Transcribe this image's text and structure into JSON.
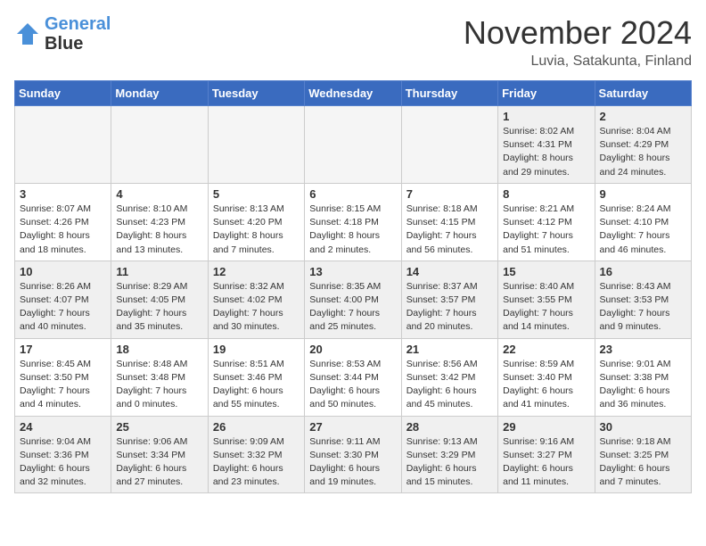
{
  "header": {
    "logo_line1": "General",
    "logo_line2": "Blue",
    "month": "November 2024",
    "location": "Luvia, Satakunta, Finland"
  },
  "weekdays": [
    "Sunday",
    "Monday",
    "Tuesday",
    "Wednesday",
    "Thursday",
    "Friday",
    "Saturday"
  ],
  "weeks": [
    [
      {
        "day": "",
        "info": "",
        "empty": true
      },
      {
        "day": "",
        "info": "",
        "empty": true
      },
      {
        "day": "",
        "info": "",
        "empty": true
      },
      {
        "day": "",
        "info": "",
        "empty": true
      },
      {
        "day": "",
        "info": "",
        "empty": true
      },
      {
        "day": "1",
        "info": "Sunrise: 8:02 AM\nSunset: 4:31 PM\nDaylight: 8 hours and 29 minutes."
      },
      {
        "day": "2",
        "info": "Sunrise: 8:04 AM\nSunset: 4:29 PM\nDaylight: 8 hours and 24 minutes."
      }
    ],
    [
      {
        "day": "3",
        "info": "Sunrise: 8:07 AM\nSunset: 4:26 PM\nDaylight: 8 hours and 18 minutes."
      },
      {
        "day": "4",
        "info": "Sunrise: 8:10 AM\nSunset: 4:23 PM\nDaylight: 8 hours and 13 minutes."
      },
      {
        "day": "5",
        "info": "Sunrise: 8:13 AM\nSunset: 4:20 PM\nDaylight: 8 hours and 7 minutes."
      },
      {
        "day": "6",
        "info": "Sunrise: 8:15 AM\nSunset: 4:18 PM\nDaylight: 8 hours and 2 minutes."
      },
      {
        "day": "7",
        "info": "Sunrise: 8:18 AM\nSunset: 4:15 PM\nDaylight: 7 hours and 56 minutes."
      },
      {
        "day": "8",
        "info": "Sunrise: 8:21 AM\nSunset: 4:12 PM\nDaylight: 7 hours and 51 minutes."
      },
      {
        "day": "9",
        "info": "Sunrise: 8:24 AM\nSunset: 4:10 PM\nDaylight: 7 hours and 46 minutes."
      }
    ],
    [
      {
        "day": "10",
        "info": "Sunrise: 8:26 AM\nSunset: 4:07 PM\nDaylight: 7 hours and 40 minutes."
      },
      {
        "day": "11",
        "info": "Sunrise: 8:29 AM\nSunset: 4:05 PM\nDaylight: 7 hours and 35 minutes."
      },
      {
        "day": "12",
        "info": "Sunrise: 8:32 AM\nSunset: 4:02 PM\nDaylight: 7 hours and 30 minutes."
      },
      {
        "day": "13",
        "info": "Sunrise: 8:35 AM\nSunset: 4:00 PM\nDaylight: 7 hours and 25 minutes."
      },
      {
        "day": "14",
        "info": "Sunrise: 8:37 AM\nSunset: 3:57 PM\nDaylight: 7 hours and 20 minutes."
      },
      {
        "day": "15",
        "info": "Sunrise: 8:40 AM\nSunset: 3:55 PM\nDaylight: 7 hours and 14 minutes."
      },
      {
        "day": "16",
        "info": "Sunrise: 8:43 AM\nSunset: 3:53 PM\nDaylight: 7 hours and 9 minutes."
      }
    ],
    [
      {
        "day": "17",
        "info": "Sunrise: 8:45 AM\nSunset: 3:50 PM\nDaylight: 7 hours and 4 minutes."
      },
      {
        "day": "18",
        "info": "Sunrise: 8:48 AM\nSunset: 3:48 PM\nDaylight: 7 hours and 0 minutes."
      },
      {
        "day": "19",
        "info": "Sunrise: 8:51 AM\nSunset: 3:46 PM\nDaylight: 6 hours and 55 minutes."
      },
      {
        "day": "20",
        "info": "Sunrise: 8:53 AM\nSunset: 3:44 PM\nDaylight: 6 hours and 50 minutes."
      },
      {
        "day": "21",
        "info": "Sunrise: 8:56 AM\nSunset: 3:42 PM\nDaylight: 6 hours and 45 minutes."
      },
      {
        "day": "22",
        "info": "Sunrise: 8:59 AM\nSunset: 3:40 PM\nDaylight: 6 hours and 41 minutes."
      },
      {
        "day": "23",
        "info": "Sunrise: 9:01 AM\nSunset: 3:38 PM\nDaylight: 6 hours and 36 minutes."
      }
    ],
    [
      {
        "day": "24",
        "info": "Sunrise: 9:04 AM\nSunset: 3:36 PM\nDaylight: 6 hours and 32 minutes."
      },
      {
        "day": "25",
        "info": "Sunrise: 9:06 AM\nSunset: 3:34 PM\nDaylight: 6 hours and 27 minutes."
      },
      {
        "day": "26",
        "info": "Sunrise: 9:09 AM\nSunset: 3:32 PM\nDaylight: 6 hours and 23 minutes."
      },
      {
        "day": "27",
        "info": "Sunrise: 9:11 AM\nSunset: 3:30 PM\nDaylight: 6 hours and 19 minutes."
      },
      {
        "day": "28",
        "info": "Sunrise: 9:13 AM\nSunset: 3:29 PM\nDaylight: 6 hours and 15 minutes."
      },
      {
        "day": "29",
        "info": "Sunrise: 9:16 AM\nSunset: 3:27 PM\nDaylight: 6 hours and 11 minutes."
      },
      {
        "day": "30",
        "info": "Sunrise: 9:18 AM\nSunset: 3:25 PM\nDaylight: 6 hours and 7 minutes."
      }
    ]
  ]
}
